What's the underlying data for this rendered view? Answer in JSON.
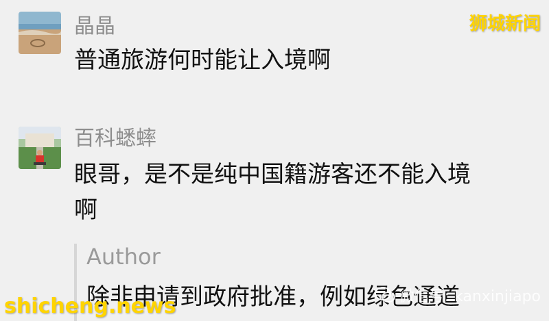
{
  "messages": [
    {
      "nickname": "晶晶",
      "text": "普通旅游何时能让入境啊"
    },
    {
      "nickname": "百科蟋蟀",
      "text_line1": "眼哥，是不是纯中国籍游客还不能入境",
      "text_line2": "啊"
    }
  ],
  "quote": {
    "author": "Author",
    "text": "除非申请到政府批准，例如绿色通道"
  },
  "watermarks": {
    "top_right": "狮城新闻",
    "bottom_left": "shicheng.news",
    "wechat_account": "微信号: kanxinjiapo"
  },
  "colors": {
    "background": "#f0f0f0",
    "nickname": "#8d8d8d",
    "text": "#111111",
    "watermark": "#ffd400"
  }
}
